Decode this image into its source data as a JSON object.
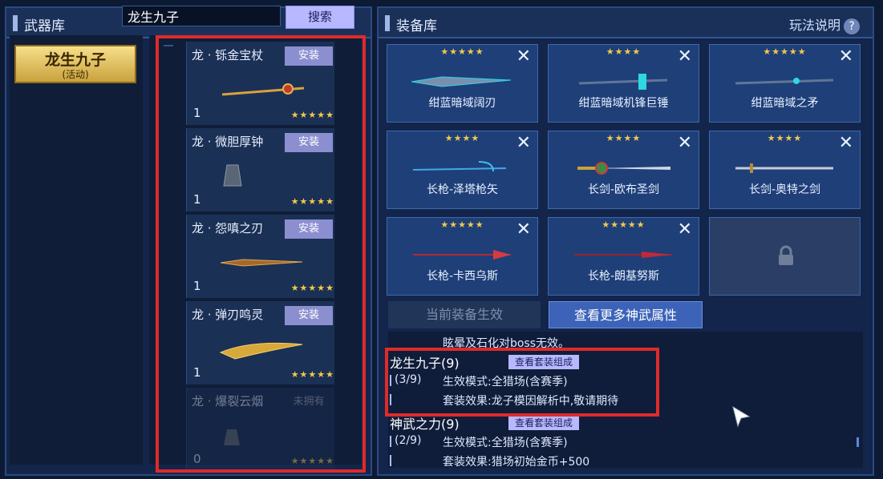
{
  "left": {
    "title": "武器库",
    "search_value": "龙生九子",
    "search_button": "搜索",
    "category": {
      "name": "龙生九子",
      "sub": "(活动)"
    },
    "weapons": [
      {
        "name": "龙 · 铄金宝杖",
        "install": "安装",
        "count": "1",
        "stars": "★★★★★"
      },
      {
        "name": "龙 · 微胆厚钟",
        "install": "安装",
        "count": "1",
        "stars": "★★★★★"
      },
      {
        "name": "龙 · 怨嗔之刃",
        "install": "安装",
        "count": "1",
        "stars": "★★★★★"
      },
      {
        "name": "龙 · 弹刃鸣灵",
        "install": "安装",
        "count": "1",
        "stars": "★★★★★"
      },
      {
        "name": "龙 · 爆裂云烟",
        "install": "未拥有",
        "count": "0",
        "stars": "★★★★★"
      }
    ]
  },
  "right": {
    "title": "装备库",
    "help": "玩法说明",
    "help_icon": "?",
    "slots": [
      {
        "name": "绀蓝暗域阔刃",
        "stars": "★★★★★",
        "close": "✕"
      },
      {
        "name": "绀蓝暗域机锋巨锤",
        "stars": "★★★★",
        "close": "✕"
      },
      {
        "name": "绀蓝暗域之矛",
        "stars": "★★★★★",
        "close": "✕"
      },
      {
        "name": "长枪-泽塔枪矢",
        "stars": "★★★★",
        "close": "✕"
      },
      {
        "name": "长剑-欧布圣剑",
        "stars": "★★★★",
        "close": "✕"
      },
      {
        "name": "长剑-奥特之剑",
        "stars": "★★★★",
        "close": "✕"
      },
      {
        "name": "长枪-卡西乌斯",
        "stars": "★★★★★",
        "close": "✕"
      },
      {
        "name": "长枪-朗基努斯",
        "stars": "★★★★★",
        "close": "✕"
      }
    ],
    "tabs": {
      "effect": "当前装备生效",
      "more": "查看更多神武属性"
    },
    "info": {
      "top_line": "眩晕及石化对boss无效。",
      "set1": {
        "name": "龙生九子(9)",
        "view": "查看套装组成",
        "progress": "(3/9)",
        "mode": "生效模式:全猎场(含赛季)",
        "effect": "套装效果:龙子模因解析中,敬请期待"
      },
      "set2": {
        "name": "神武之力(9)",
        "view": "查看套装组成",
        "progress": "(2/9)",
        "mode": "生效模式:全猎场(含赛季)",
        "effect": "套装效果:猎场初始金币+500"
      }
    }
  },
  "colors": {
    "accent": "#b7b8ff",
    "highlight": "#e02a2a",
    "star": "#f3c948"
  }
}
